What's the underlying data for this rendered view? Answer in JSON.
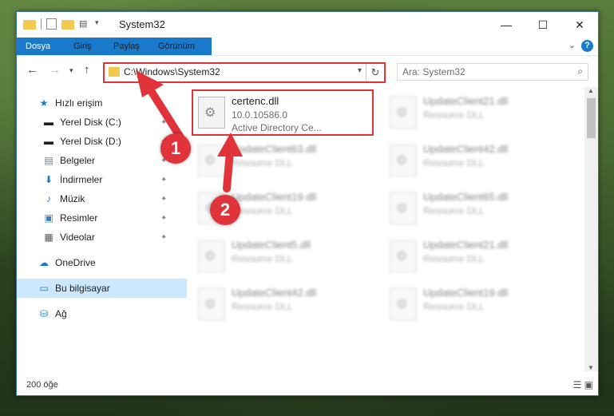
{
  "window": {
    "title": "System32",
    "minimize": "—",
    "maximize": "☐",
    "close": "✕"
  },
  "ribbon": {
    "tabs": [
      {
        "label": "Dosya"
      },
      {
        "label": "Giriş"
      },
      {
        "label": "Paylaş"
      },
      {
        "label": "Görünüm"
      }
    ],
    "help": "?"
  },
  "address": {
    "path": "C:\\Windows\\System32"
  },
  "search": {
    "placeholder": "Ara: System32"
  },
  "nav": {
    "items": [
      {
        "label": "Hızlı erişim",
        "icon": "star-icon"
      },
      {
        "label": "Yerel Disk (C:)",
        "icon": "drive-icon"
      },
      {
        "label": "Yerel Disk (D:)",
        "icon": "drive-icon"
      },
      {
        "label": "Belgeler",
        "icon": "documents-icon"
      },
      {
        "label": "İndirmeler",
        "icon": "download-icon"
      },
      {
        "label": "Müzik",
        "icon": "music-icon"
      },
      {
        "label": "Resimler",
        "icon": "pictures-icon"
      },
      {
        "label": "Videolar",
        "icon": "videos-icon"
      },
      {
        "label": "OneDrive",
        "icon": "cloud-icon"
      },
      {
        "label": "Bu bilgisayar",
        "icon": "computer-icon"
      },
      {
        "label": "Ağ",
        "icon": "network-icon"
      }
    ]
  },
  "files": [
    {
      "name": "certenc.dll",
      "line2": "10.0.10586.0",
      "line3": "Active Directory Ce..."
    },
    {
      "name": "UpdateClient21.dll",
      "line2": "Resource DLL"
    },
    {
      "name": "UpdateClient63.dll",
      "line2": "Resource DLL"
    },
    {
      "name": "UpdateClient42.dll",
      "line2": "Resource DLL"
    },
    {
      "name": "UpdateClient19.dll",
      "line2": "Resource DLL"
    },
    {
      "name": "UpdateClient65.dll",
      "line2": "Resource DLL"
    },
    {
      "name": "UpdateClient5.dll",
      "line2": "Resource DLL"
    },
    {
      "name": "UpdateClient21.dll",
      "line2": "Resource DLL"
    },
    {
      "name": "UpdateClient42.dll",
      "line2": "Resource DLL"
    },
    {
      "name": "UpdateClient19.dll",
      "line2": "Resource DLL"
    }
  ],
  "status": {
    "count": "200 öğe"
  },
  "annotations": {
    "step1": "1",
    "step2": "2"
  },
  "colors": {
    "accent": "#1979ca",
    "highlight": "#e0343a",
    "selected": "#cce8ff"
  }
}
